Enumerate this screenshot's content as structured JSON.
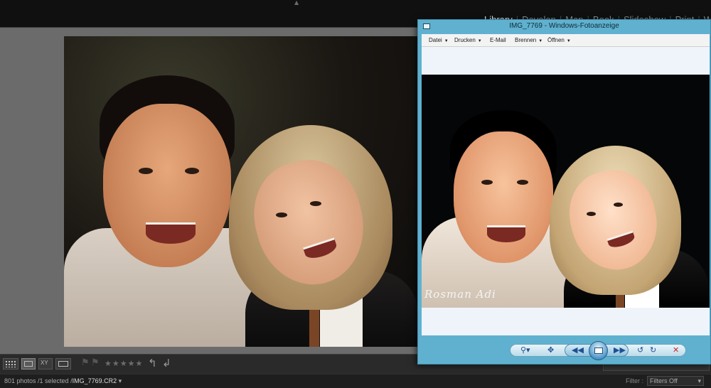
{
  "lightroom": {
    "modules": [
      "Library",
      "Develop",
      "Map",
      "Book",
      "Slideshow",
      "Print",
      "Web"
    ],
    "active_module": "Library",
    "toolbar": {
      "stars": "★★★★★"
    },
    "status": {
      "count": "801 photos /1 selected /",
      "path": "IMG_7769.CR2",
      "path_caret": "▾",
      "filter_label": "Filter :",
      "filter_value": "Filters Off"
    }
  },
  "photo_viewer": {
    "title": "IMG_7769 - Windows-Fotoanzeige",
    "menu": [
      {
        "label": "Datei",
        "has_dropdown": true
      },
      {
        "label": "Drucken",
        "has_dropdown": true
      },
      {
        "label": "E-Mail",
        "has_dropdown": false
      },
      {
        "label": "Brennen",
        "has_dropdown": true
      },
      {
        "label": "Öffnen",
        "has_dropdown": true
      }
    ],
    "watermark": "Rosman Adi"
  },
  "colors": {
    "lightroom_background": "#6b6b6b",
    "viewer_frame": "#5fb1cf",
    "viewer_background": "#eef4fa"
  },
  "icons": {
    "nav": [
      "zoom-icon",
      "fit-icon",
      "previous-icon",
      "slideshow-icon",
      "next-icon",
      "rotate-left-icon",
      "rotate-right-icon",
      "delete-icon"
    ]
  }
}
